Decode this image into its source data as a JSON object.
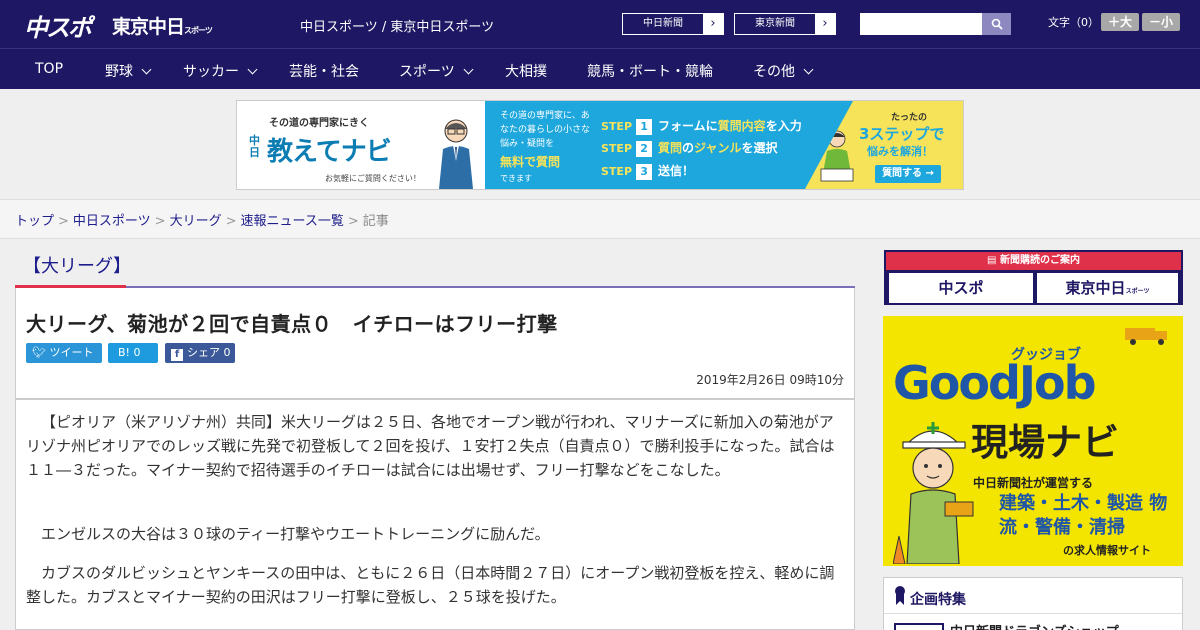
{
  "header": {
    "logo_chuspo": "中スポ",
    "logo_tokyo": "東京中日",
    "logo_tokyo_suffix": "スポーツ",
    "site_links": "中日スポーツ / 東京中日スポーツ",
    "paper_buttons": [
      {
        "label": "中日新聞"
      },
      {
        "label": "東京新聞"
      }
    ],
    "search": {
      "placeholder": ""
    },
    "font_size": {
      "label": "文字（0）",
      "bigger": "＋大",
      "smaller": "－小"
    }
  },
  "nav": {
    "items": [
      {
        "label": "TOP"
      },
      {
        "label": "野球"
      },
      {
        "label": "サッカー"
      },
      {
        "label": "芸能・社会"
      },
      {
        "label": "スポーツ"
      },
      {
        "label": "大相撲"
      },
      {
        "label": "競馬・ボート・競輪"
      },
      {
        "label": "その他"
      }
    ]
  },
  "ad_banner": {
    "left_top": "その道の専門家にきく",
    "left_side": "中日",
    "left_title": "教えてナビ",
    "left_note": "お気軽にご質問ください！",
    "mid_text": "その道の専門家に、あなたの暮らしの小さな悩み・疑問を",
    "mid_highlight": "無料で質問",
    "mid_tail": "できます",
    "steps": [
      {
        "step": "STEP",
        "num": "1",
        "pre": "フォーム",
        "mid": "に",
        "hl": "質問内容",
        "post": "を入力"
      },
      {
        "step": "STEP",
        "num": "2",
        "pre": "質問",
        "mid": "の",
        "hl": "ジャンル",
        "post": "を選択"
      },
      {
        "step": "STEP",
        "num": "3",
        "pre": "送信！",
        "mid": "",
        "hl": "",
        "post": ""
      }
    ],
    "right_top": "たったの",
    "right_big": "3ステップで",
    "right_mid": "悩みを解消！",
    "right_button": "質問する →"
  },
  "breadcrumb": {
    "items": [
      "トップ",
      "中日スポーツ",
      "大リーグ",
      "速報ニュース一覧"
    ],
    "current": "記事"
  },
  "article": {
    "category": "【大リーグ】",
    "headline": "大リーグ、菊池が２回で自責点０　イチローはフリー打撃",
    "share": {
      "tweet": "ツイート",
      "hatena": "B! 0",
      "facebook": "シェア 0"
    },
    "datetime": "2019年2月26日 09時10分",
    "paragraphs": [
      "【ピオリア（米アリゾナ州）共同】米大リーグは２５日、各地でオープン戦が行われ、マリナーズに新加入の菊池がアリゾナ州ピオリアでのレッズ戦に先発で初登板して２回を投げ、１安打２失点（自責点０）で勝利投手になった。試合は１１―３だった。マイナー契約で招待選手のイチローは試合には出場せず、フリー打撃などをこなした。",
      "エンゼルスの大谷は３０球のティー打撃やウエートトレーニングに励んだ。",
      "カブスのダルビッシュとヤンキースの田中は、ともに２６日（日本時間２７日）にオープン戦初登板を控え、軽めに調整した。カブスとマイナー契約の田沢はフリー打撃に登板し、２５球を投げた。"
    ]
  },
  "sidebar": {
    "subscribe_title": "新聞購読のご案内",
    "subscribe_buttons": [
      "中スポ",
      "東京中日"
    ],
    "subscribe_suffix": "スポーツ",
    "goodjob": {
      "kana": "グッジョブ",
      "title": "GoodJob",
      "subtitle": "現場ナビ",
      "operator": "中日新聞社が運営する",
      "fields": "建築・土木・製造 物流・警備・清掃",
      "tail": "の求人情報サイト"
    },
    "feature_title": "企画特集",
    "feature_item": "中日新聞ドラゴンズショップ"
  }
}
